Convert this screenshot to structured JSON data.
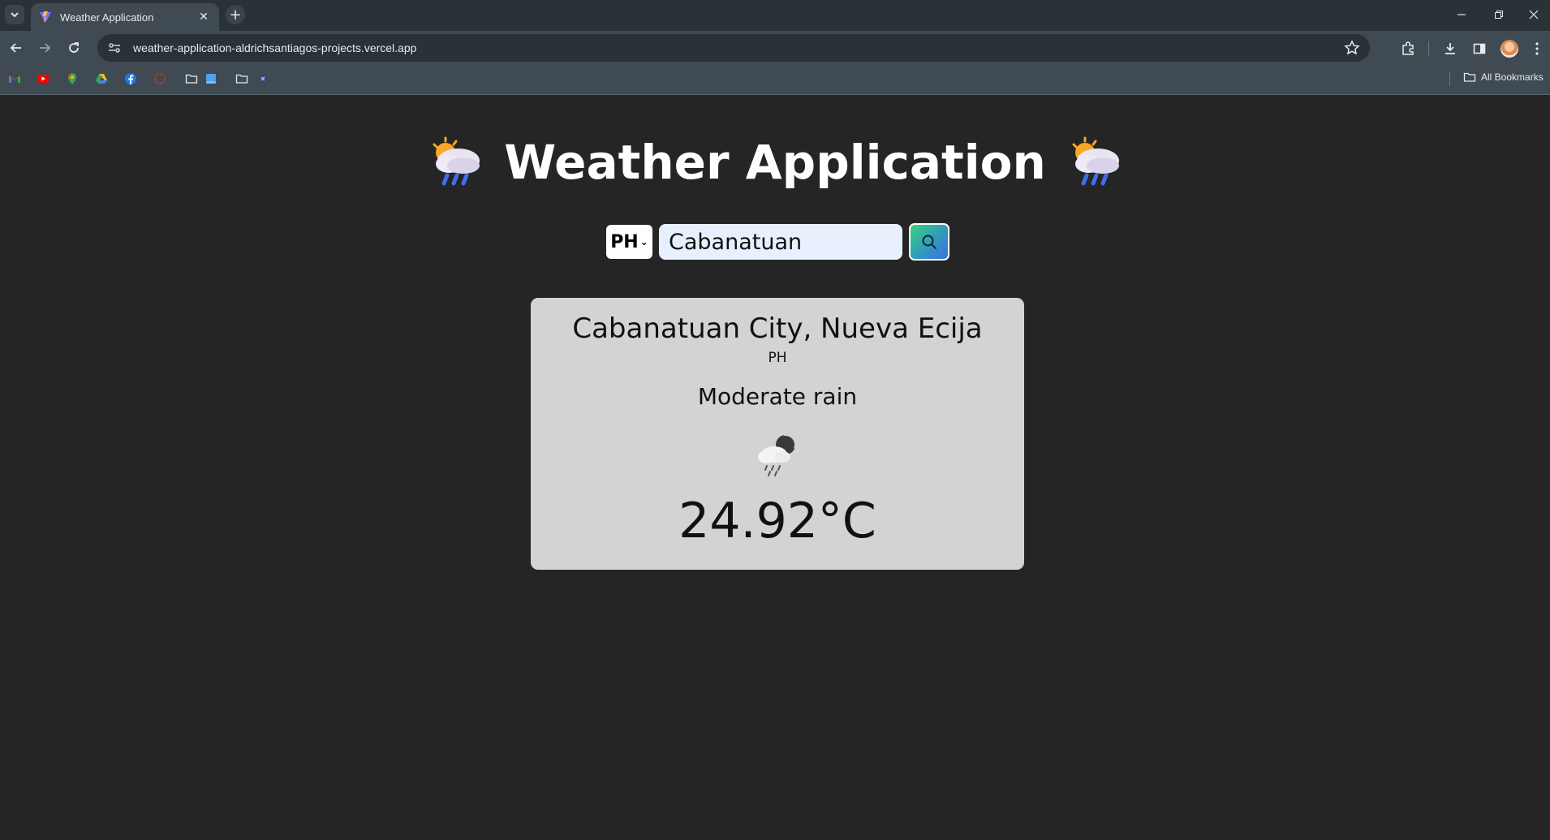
{
  "browser": {
    "tab": {
      "title": "Weather Application"
    },
    "address_bar": {
      "url": "weather-application-aldrichsantiagos-projects.vercel.app"
    },
    "bookmarks_bar": {
      "items": [
        "gmail-icon",
        "youtube-icon",
        "maps-icon",
        "drive-icon",
        "facebook-icon",
        "circle-icon",
        "folder-icon",
        "app-icon",
        "folder-icon",
        "x-icon"
      ],
      "all_bookmarks_label": "All Bookmarks"
    }
  },
  "app": {
    "title": "Weather Application",
    "country_select": {
      "value": "PH"
    },
    "city_input": {
      "value": "Cabanatuan"
    },
    "search_button": {
      "icon": "search-icon"
    }
  },
  "weather": {
    "location": "Cabanatuan City, Nueva Ecija",
    "country": "PH",
    "description": "Moderate rain",
    "temperature": "24.92°C",
    "icon": "rain-cloud-night-icon"
  },
  "colors": {
    "page_bg": "#252526",
    "card_bg": "#d3d3d3",
    "chrome_frame": "#2a3238",
    "chrome_toolbar": "#3f4a52"
  }
}
